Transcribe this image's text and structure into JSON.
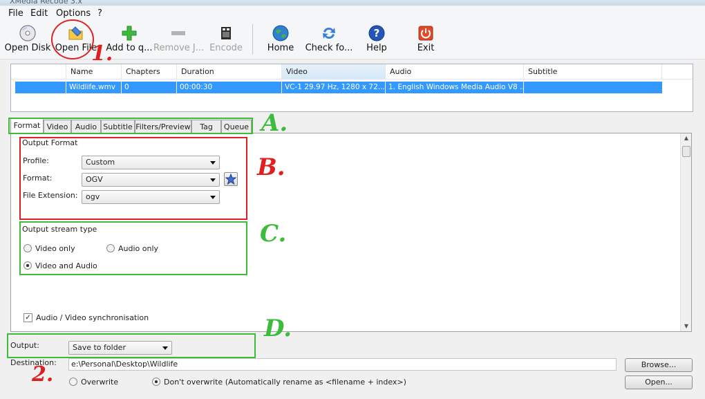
{
  "window": {
    "title": "XMedia Recode 3.x"
  },
  "menu": [
    "File",
    "Edit",
    "Options",
    "?"
  ],
  "toolbar": {
    "buttons": [
      {
        "label": "Open Disk",
        "icon": "disc-icon",
        "enabled": true
      },
      {
        "label": "Open File",
        "icon": "open-file-icon",
        "enabled": true
      },
      {
        "label": "Add to q...",
        "icon": "plus-icon",
        "enabled": true
      },
      {
        "label": "Remove J...",
        "icon": "minus-icon",
        "enabled": false
      },
      {
        "label": "Encode",
        "icon": "film-icon",
        "enabled": false
      },
      {
        "label": "Home",
        "icon": "globe-icon",
        "enabled": true
      },
      {
        "label": "Check fo...",
        "icon": "refresh-icon",
        "enabled": true
      },
      {
        "label": "Help",
        "icon": "help-icon",
        "enabled": true
      },
      {
        "label": "Exit",
        "icon": "power-icon",
        "enabled": true
      }
    ]
  },
  "queue": {
    "columns": [
      "Name",
      "Chapters",
      "Duration",
      "Video",
      "Audio",
      "Subtitle"
    ],
    "rows": [
      {
        "name": "Wildlife.wmv",
        "chapters": "0",
        "duration": "00:00:30",
        "video": "VC-1 29.97 Hz, 1280 x 72...",
        "audio": "1. English Windows Media Audio V8 ...",
        "subtitle": ""
      }
    ]
  },
  "tabs": [
    "Format",
    "Video",
    "Audio",
    "Subtitle",
    "Filters/Preview",
    "Tag",
    "Queue"
  ],
  "format_tab": {
    "output_format": {
      "title": "Output Format",
      "profile_label": "Profile:",
      "profile_value": "Custom",
      "format_label": "Format:",
      "format_value": "OGV",
      "extension_label": "File Extension:",
      "extension_value": "ogv"
    },
    "stream_type": {
      "title": "Output stream type",
      "video_only": "Video only",
      "audio_only": "Audio only",
      "video_and_audio": "Video and Audio",
      "selected": "video_and_audio"
    },
    "sync_label": "Audio / Video synchronisation",
    "sync_checked": true
  },
  "output": {
    "label": "Output:",
    "value": "Save to folder",
    "destination_label": "Destination:",
    "destination_value": "e:\\Personal\\Desktop\\Wildlife",
    "browse_label": "Browse...",
    "open_label": "Open...",
    "overwrite_label": "Overwrite",
    "dont_overwrite_label": "Don't overwrite (Automatically rename as <filename + index>)",
    "overwrite_selected": "dont_overwrite"
  },
  "annotations": {
    "one": "1.",
    "two": "2.",
    "a": "A.",
    "b": "B.",
    "c": "C.",
    "d": "D."
  },
  "colors": {
    "selection": "#3399ff",
    "annotation_red": "#e02020",
    "annotation_green": "#3dbb3d"
  }
}
